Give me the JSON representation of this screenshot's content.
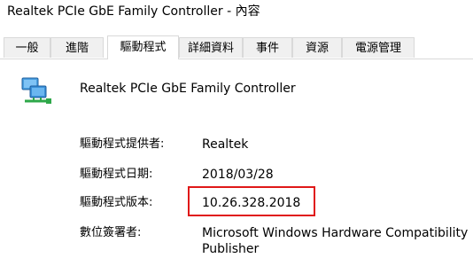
{
  "window": {
    "title": "Realtek PCIe GbE Family Controller - 內容"
  },
  "tabs": [
    {
      "label": "一般"
    },
    {
      "label": "進階"
    },
    {
      "label": "驅動程式"
    },
    {
      "label": "詳細資料"
    },
    {
      "label": "事件"
    },
    {
      "label": "資源"
    },
    {
      "label": "電源管理"
    }
  ],
  "active_tab": "驅動程式",
  "device": {
    "name": "Realtek PCIe GbE Family Controller",
    "icon": "network-adapter-icon"
  },
  "driver": {
    "provider_label": "驅動程式提供者:",
    "provider_value": "Realtek",
    "date_label": "驅動程式日期:",
    "date_value": "2018/03/28",
    "version_label": "驅動程式版本:",
    "version_value": "10.26.328.2018",
    "signer_label": "數位簽署者:",
    "signer_value_line1": "Microsoft Windows Hardware Compatibility",
    "signer_value_line2": "Publisher"
  },
  "colors": {
    "highlight": "#e01818",
    "tab_border": "#d9d9d9",
    "tab_bg": "#f0f0f0"
  }
}
